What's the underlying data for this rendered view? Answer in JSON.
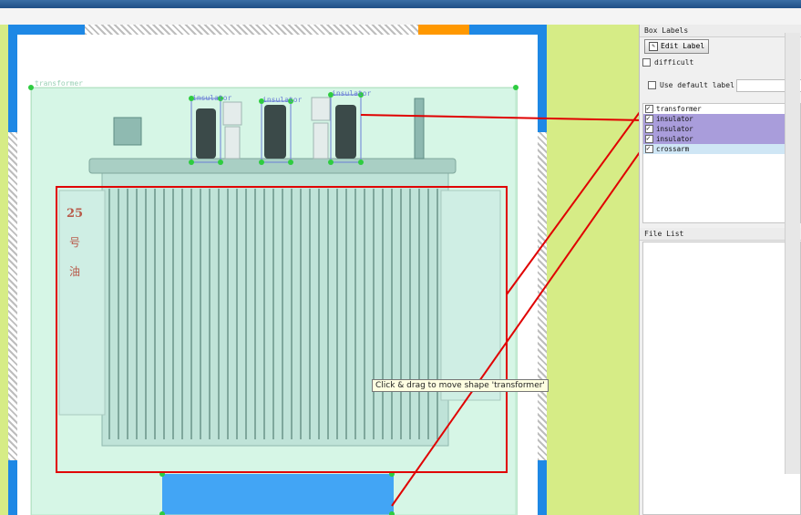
{
  "canvas": {
    "labels": [
      {
        "text": "transformer"
      },
      {
        "text": "insulator"
      },
      {
        "text": "insulator"
      },
      {
        "text": "insulator"
      }
    ],
    "tooltip": "Click & drag to move shape 'transformer'",
    "oil_marks": [
      "25",
      "号",
      "油"
    ]
  },
  "sidebar": {
    "box_labels_title": "Box Labels",
    "edit_label_button": "Edit Label",
    "difficult_label": "difficult",
    "use_default_label": "Use default label",
    "default_label_value": "",
    "label_list": [
      {
        "name": "transformer",
        "checked": true
      },
      {
        "name": "insulator",
        "checked": true
      },
      {
        "name": "insulator",
        "checked": true
      },
      {
        "name": "insulator",
        "checked": true
      },
      {
        "name": "crossarm",
        "checked": true
      }
    ],
    "file_list_title": "File List"
  },
  "colors": {
    "canvas_bg": "#d6ec86",
    "annotation_green": "#2ecc40",
    "selection_purple": "#a99ddb",
    "annotation_red": "#e00000",
    "frame_blue": "#1e88e5"
  }
}
